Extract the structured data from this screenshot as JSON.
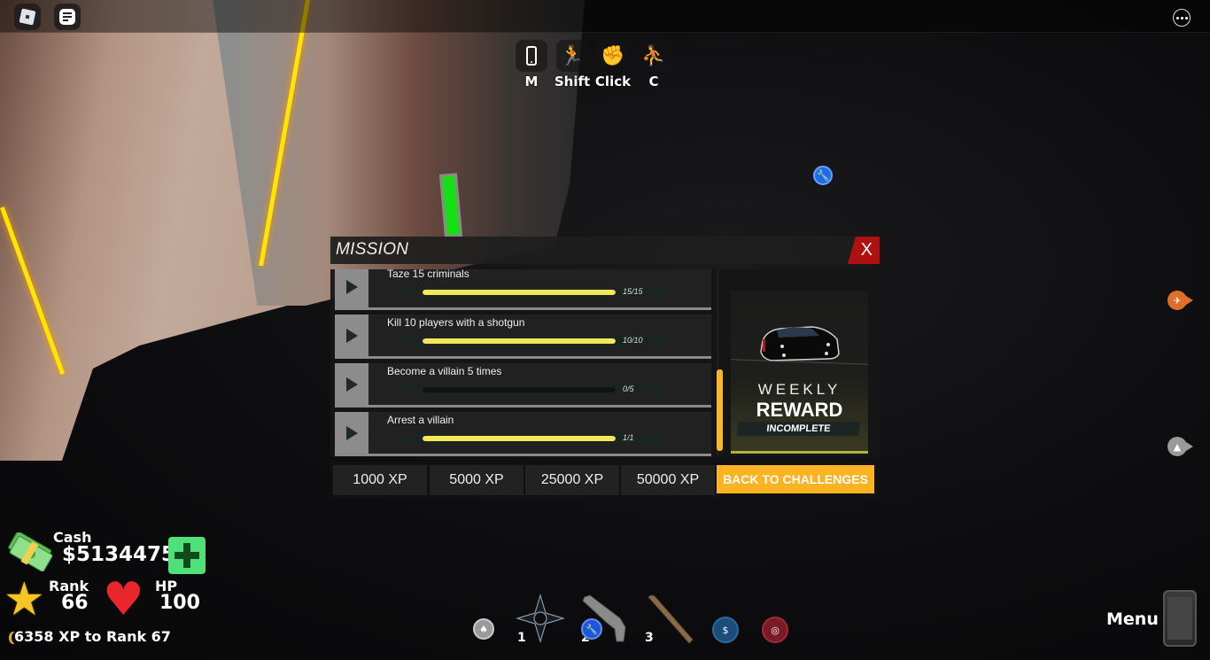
{
  "topbar": {
    "roblox_icon": "roblox-logo-icon",
    "chat_icon": "chat-icon",
    "more_icon": "more-options-icon"
  },
  "keybinds": [
    {
      "icon": "phone-icon",
      "key": "M"
    },
    {
      "icon": "sprint-icon",
      "key": "Shift"
    },
    {
      "icon": "punch-icon",
      "key": "Click"
    },
    {
      "icon": "crawl-icon",
      "key": "C"
    }
  ],
  "mission": {
    "title": "MISSION",
    "close_label": "X",
    "tasks": [
      {
        "label": "Taze 15 criminals",
        "progress": "15/15",
        "fraction": 1.0
      },
      {
        "label": "Kill 10 players with a shotgun",
        "progress": "10/10",
        "fraction": 1.0
      },
      {
        "label": "Become a villain 5 times",
        "progress": "0/5",
        "fraction": 0.0
      },
      {
        "label": "Arrest a villain",
        "progress": "1/1",
        "fraction": 1.0
      }
    ],
    "reward": {
      "weekly": "WEEKLY",
      "reward": "REWARD",
      "status": "INCOMPLETE"
    },
    "xp_tabs": [
      "1000 XP",
      "5000 XP",
      "25000 XP",
      "50000 XP"
    ],
    "back_button": "BACK TO CHALLENGES"
  },
  "hud": {
    "cash_label": "Cash",
    "cash_value": "$5134475",
    "rank_label": "Rank",
    "rank_value": "66",
    "hp_label": "HP",
    "hp_value": "100",
    "xp_to_next": "6358 XP to Rank 67"
  },
  "hotbar": {
    "slots": [
      {
        "num": "1",
        "item": "shuriken"
      },
      {
        "num": "2",
        "item": "shotgun"
      },
      {
        "num": "3",
        "item": "baseball-bat"
      }
    ]
  },
  "menu": {
    "label": "Menu"
  },
  "colors": {
    "accent": "#fbb321",
    "progress_fill": "#f4e85a",
    "close": "#b01010",
    "cash_add": "#4fe07a"
  }
}
